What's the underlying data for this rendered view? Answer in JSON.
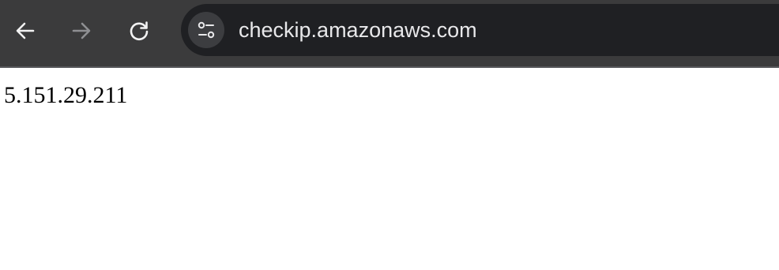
{
  "browser": {
    "toolbar": {
      "back_icon": "arrow-left-icon",
      "forward_icon": "arrow-right-icon",
      "reload_icon": "reload-icon",
      "forward_enabled": false
    },
    "address_bar": {
      "site_info_icon": "tune-icon",
      "url": "checkip.amazonaws.com"
    },
    "colors": {
      "toolbar_bg": "#3b3b3c",
      "omnibox_bg": "#1f2023",
      "page_bg": "#ffffff"
    }
  },
  "page": {
    "ip_address": "5.151.29.211"
  }
}
